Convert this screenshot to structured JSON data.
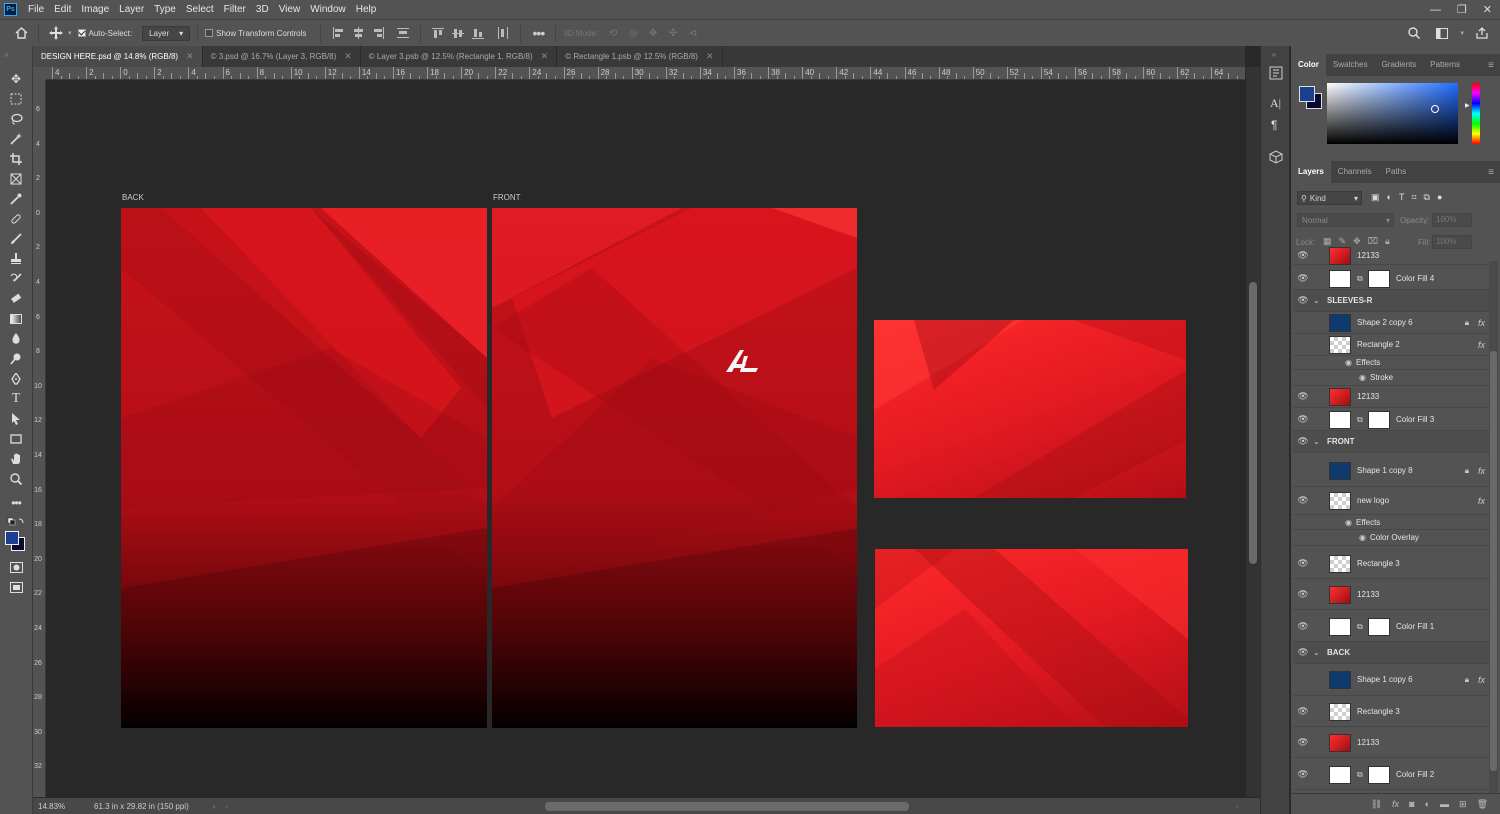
{
  "app": {
    "logo": "Ps"
  },
  "menu": [
    "File",
    "Edit",
    "Image",
    "Layer",
    "Type",
    "Select",
    "Filter",
    "3D",
    "View",
    "Window",
    "Help"
  ],
  "options": {
    "auto_select_label": "Auto-Select:",
    "auto_select_value": "Layer",
    "show_transform_label": "Show Transform Controls",
    "mode_3d": "3D Mode:"
  },
  "tabs": [
    {
      "label": "DESIGN HERE.psd @ 14.8% (RGB/8)",
      "active": true
    },
    {
      "label": "© 3.psd @ 16.7% (Layer 3, RGB/8)"
    },
    {
      "label": "© Layer 3.psb @ 12.5% (Rectangle 1, RGB/8)"
    },
    {
      "label": "© Rectangle 1.psb @ 12.5% (RGB/8)"
    }
  ],
  "ruler_top": [
    "4",
    "2",
    "0",
    "2",
    "4",
    "6",
    "8",
    "10",
    "12",
    "14",
    "16",
    "18",
    "20",
    "22",
    "24",
    "26",
    "28",
    "30",
    "32",
    "34",
    "36",
    "38",
    "40",
    "42",
    "44",
    "46",
    "48",
    "50",
    "52",
    "54",
    "56",
    "58",
    "60",
    "62",
    "64"
  ],
  "ruler_left": [
    "6",
    "4",
    "2",
    "0",
    "2",
    "4",
    "6",
    "8",
    "10",
    "12",
    "14",
    "16",
    "18",
    "20",
    "22",
    "24",
    "26",
    "28",
    "30",
    "32"
  ],
  "canvas": {
    "label_back": "BACK",
    "label_front": "FRONT"
  },
  "status": {
    "zoom": "14.83%",
    "doc_size": "61.3 in x 29.82 in (150 ppi)"
  },
  "color_panel": {
    "tabs": [
      "Color",
      "Swatches",
      "Gradients",
      "Patterns"
    ],
    "fg": "#1a3f8f",
    "bg": "#0a0a30"
  },
  "layers_panel": {
    "tabs": [
      "Layers",
      "Channels",
      "Paths"
    ],
    "kind": "Kind",
    "blend": "Normal",
    "opacity_label": "Opacity:",
    "opacity": "100%",
    "lock_label": "Lock:",
    "fill_label": "Fill:",
    "fill": "100%",
    "layers": [
      {
        "name": "12133",
        "type": "red"
      },
      {
        "name": "Color Fill 4",
        "type": "fill"
      },
      {
        "name": "SLEEVES-R",
        "type": "group"
      },
      {
        "name": "Shape 2 copy 6",
        "type": "blue"
      },
      {
        "name": "Rectangle 2",
        "type": "chk"
      },
      {
        "name": "Effects",
        "type": "sub"
      },
      {
        "name": "Stroke",
        "type": "sub2"
      },
      {
        "name": "12133",
        "type": "red"
      },
      {
        "name": "Color Fill 3",
        "type": "fill"
      },
      {
        "name": "FRONT",
        "type": "group"
      },
      {
        "name": "Shape 1 copy 8",
        "type": "blue"
      },
      {
        "name": "new logo",
        "type": "chk"
      },
      {
        "name": "Effects",
        "type": "sub"
      },
      {
        "name": "Color Overlay",
        "type": "sub2"
      },
      {
        "name": "Rectangle 3",
        "type": "chk"
      },
      {
        "name": "12133",
        "type": "red"
      },
      {
        "name": "Color Fill 1",
        "type": "fill"
      },
      {
        "name": "BACK",
        "type": "group"
      },
      {
        "name": "Shape 1 copy 6",
        "type": "blue"
      },
      {
        "name": "Rectangle 3",
        "type": "chk"
      },
      {
        "name": "12133",
        "type": "red"
      },
      {
        "name": "Color Fill 2",
        "type": "fill"
      }
    ]
  }
}
